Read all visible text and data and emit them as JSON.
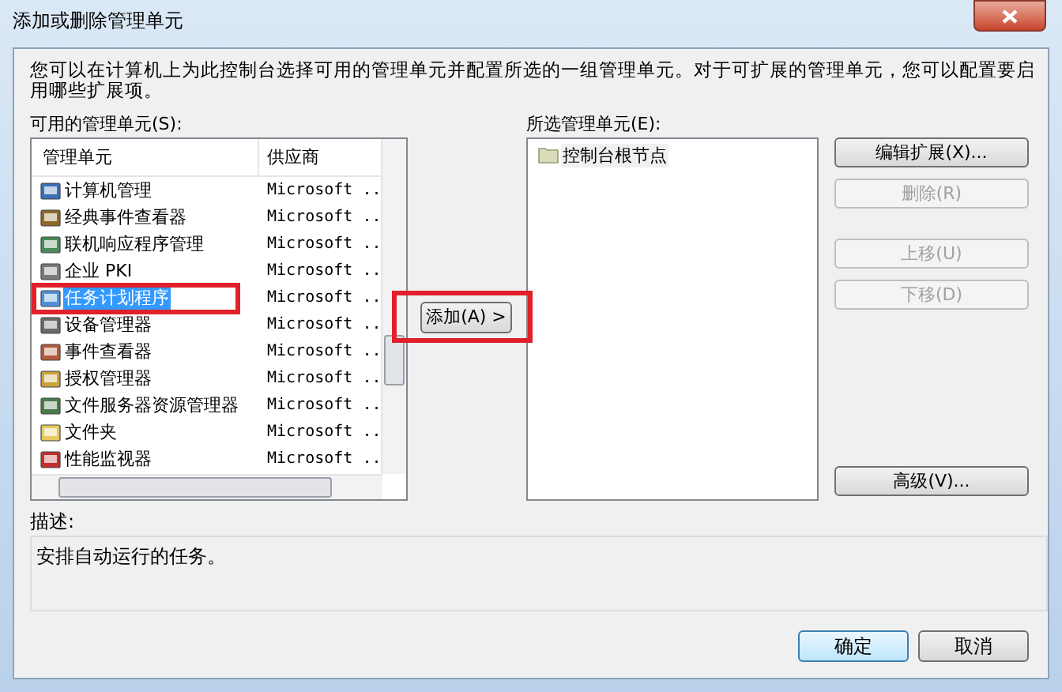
{
  "window": {
    "title": "添加或删除管理单元"
  },
  "intro": "您可以在计算机上为此控制台选择可用的管理单元并配置所选的一组管理单元。对于可扩展的管理单元，您可以配置要启用哪些扩展项。",
  "available": {
    "label": "可用的管理单元(S):",
    "columns": [
      "管理单元",
      "供应商"
    ],
    "rows": [
      {
        "name": "计算机管理",
        "vendor": "Microsoft ..",
        "selected": false
      },
      {
        "name": "经典事件查看器",
        "vendor": "Microsoft ..",
        "selected": false
      },
      {
        "name": "联机响应程序管理",
        "vendor": "Microsoft ..",
        "selected": false
      },
      {
        "name": "企业 PKI",
        "vendor": "Microsoft ..",
        "selected": false
      },
      {
        "name": "任务计划程序",
        "vendor": "Microsoft ..",
        "selected": true
      },
      {
        "name": "设备管理器",
        "vendor": "Microsoft ..",
        "selected": false
      },
      {
        "name": "事件查看器",
        "vendor": "Microsoft ..",
        "selected": false
      },
      {
        "name": "授权管理器",
        "vendor": "Microsoft ..",
        "selected": false
      },
      {
        "name": "文件服务器资源管理器",
        "vendor": "Microsoft ..",
        "selected": false
      },
      {
        "name": "文件夹",
        "vendor": "Microsoft ..",
        "selected": false
      },
      {
        "name": "性能监视器",
        "vendor": "Microsoft ..",
        "selected": false
      }
    ]
  },
  "add_button": "添加(A) >",
  "selected_list": {
    "label": "所选管理单元(E):",
    "items": [
      "控制台根节点"
    ]
  },
  "side_buttons": [
    {
      "label": "编辑扩展(X)...",
      "disabled": false
    },
    {
      "label": "删除(R)",
      "disabled": true
    },
    {
      "label": "上移(U)",
      "disabled": true
    },
    {
      "label": "下移(D)",
      "disabled": true
    },
    {
      "label": "高级(V)...",
      "disabled": false
    }
  ],
  "description": {
    "label": "描述:",
    "text": "安排自动运行的任务。"
  },
  "footer_buttons": [
    {
      "label": "确定",
      "default": true
    },
    {
      "label": "取消",
      "default": false
    }
  ]
}
